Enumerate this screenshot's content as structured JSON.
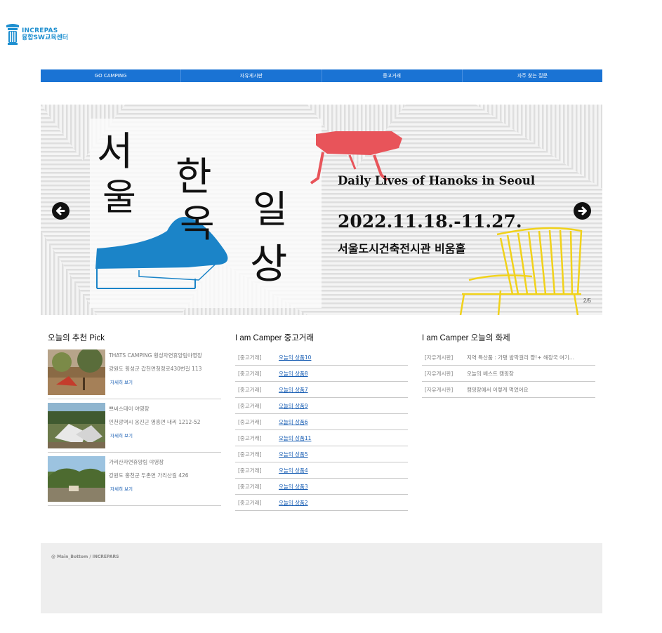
{
  "logo": {
    "line1": "INCREPAS",
    "line2": "융합SW교육센터"
  },
  "nav": [
    "GO CAMPING",
    "자유게시판",
    "중고거래",
    "자주 찾는 질문"
  ],
  "banner": {
    "title_chars": [
      "서",
      "울",
      "한",
      "옥",
      "일",
      "상"
    ],
    "english_title": "Daily Lives of Hanoks in Seoul",
    "dates": "2022.11.18.-11.27.",
    "venue": "서울도시건축전시관 비움홀",
    "indicator": "2/5"
  },
  "picks": {
    "title": "오늘의 추천 Pick",
    "items": [
      {
        "name": "THATS CAMPING 횡성자연휴양림야영장",
        "addr": "강원도 횡성군 갑천면청정로430번길 113",
        "more": "자세히 보기"
      },
      {
        "name": "쁘씨스테이 야영장",
        "addr": "인천광역시 옹진군 영흥면 내리 1212-52",
        "more": "자세히 보기"
      },
      {
        "name": "가리산자연휴양림 야영장",
        "addr": "강원도 홍천군 두촌면 가리산길 426",
        "more": "자세히 보기"
      }
    ]
  },
  "market": {
    "title": "I am Camper 중고거래",
    "rows": [
      {
        "tag": "[중고거래]",
        "link": "오늘의 상품10"
      },
      {
        "tag": "[중고거래]",
        "link": "오늘의 상품8"
      },
      {
        "tag": "[중고거래]",
        "link": "오늘의 상품7"
      },
      {
        "tag": "[중고거래]",
        "link": "오늘의 상품9"
      },
      {
        "tag": "[중고거래]",
        "link": "오늘의 상품6"
      },
      {
        "tag": "[중고거래]",
        "link": "오늘의 상품11"
      },
      {
        "tag": "[중고거래]",
        "link": "오늘의 상품5"
      },
      {
        "tag": "[중고거래]",
        "link": "오늘의 상품4"
      },
      {
        "tag": "[중고거래]",
        "link": "오늘의 상품3"
      },
      {
        "tag": "[중고거래]",
        "link": "오늘의 상품2"
      }
    ]
  },
  "topics": {
    "title": "I am Camper 오늘의 화제",
    "rows": [
      {
        "tag": "[자유게시판]",
        "text": "지역 특산품 : 가평 밤막걸리 짱!+ 해장국 여기..."
      },
      {
        "tag": "[자유게시판]",
        "text": "오늘의 베스트 캠핑장"
      },
      {
        "tag": "[자유게시판]",
        "text": "캠핑장에서 이렇게 먹었어요"
      }
    ]
  },
  "footer": {
    "text": "@ Main_Bottom / INCREPARS"
  },
  "colors": {
    "nav": "#1a73d4",
    "link": "#1a5fb4",
    "banner_red": "#e8545a",
    "banner_blue": "#1b84c8",
    "banner_yellow": "#f1d21a"
  }
}
